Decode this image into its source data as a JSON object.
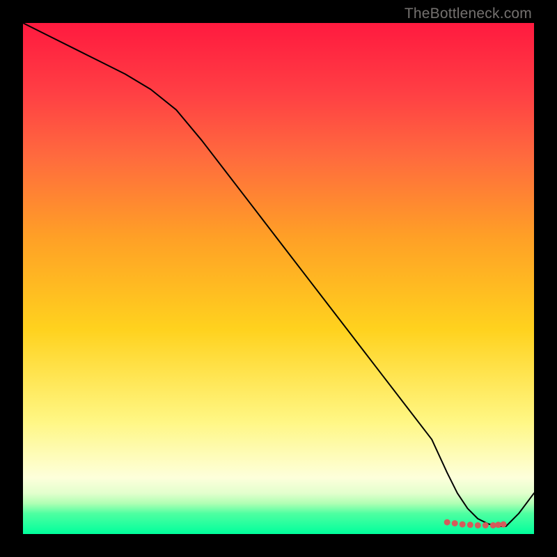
{
  "watermark": "TheBottleneck.com",
  "chart_data": {
    "type": "line",
    "title": "",
    "xlabel": "",
    "ylabel": "",
    "xlim": [
      0,
      100
    ],
    "ylim": [
      0,
      100
    ],
    "grid": false,
    "legend": false,
    "series": [
      {
        "name": "curve",
        "stroke": "#000000",
        "x": [
          0,
          5,
          10,
          15,
          20,
          25,
          30,
          35,
          40,
          45,
          50,
          55,
          60,
          65,
          70,
          75,
          80,
          83,
          85,
          87,
          89,
          91,
          93,
          94.5,
          97,
          100
        ],
        "y": [
          100,
          97.5,
          95,
          92.5,
          90,
          87,
          83,
          77,
          70.5,
          64,
          57.5,
          51,
          44.5,
          38,
          31.5,
          25,
          18.5,
          12,
          8,
          5,
          3,
          2,
          1.5,
          1.5,
          4,
          8
        ]
      }
    ],
    "markers": {
      "name": "highlight",
      "color": "#d55b5b",
      "x": [
        83,
        84.5,
        86,
        87.5,
        89,
        90.5,
        92,
        93,
        94
      ],
      "y": [
        2.3,
        2.1,
        1.9,
        1.8,
        1.7,
        1.7,
        1.7,
        1.8,
        1.9
      ]
    },
    "gradient_stops": [
      {
        "pos": 0,
        "color": "#ff1a3f"
      },
      {
        "pos": 6,
        "color": "#ff2a41"
      },
      {
        "pos": 14,
        "color": "#ff4044"
      },
      {
        "pos": 26,
        "color": "#ff6a3e"
      },
      {
        "pos": 42,
        "color": "#ffa026"
      },
      {
        "pos": 60,
        "color": "#ffd21e"
      },
      {
        "pos": 78,
        "color": "#fff784"
      },
      {
        "pos": 89,
        "color": "#fdffdb"
      },
      {
        "pos": 92,
        "color": "#e3ffcd"
      },
      {
        "pos": 94,
        "color": "#b0ffb4"
      },
      {
        "pos": 96,
        "color": "#4effa1"
      },
      {
        "pos": 100,
        "color": "#00ff9c"
      }
    ]
  }
}
